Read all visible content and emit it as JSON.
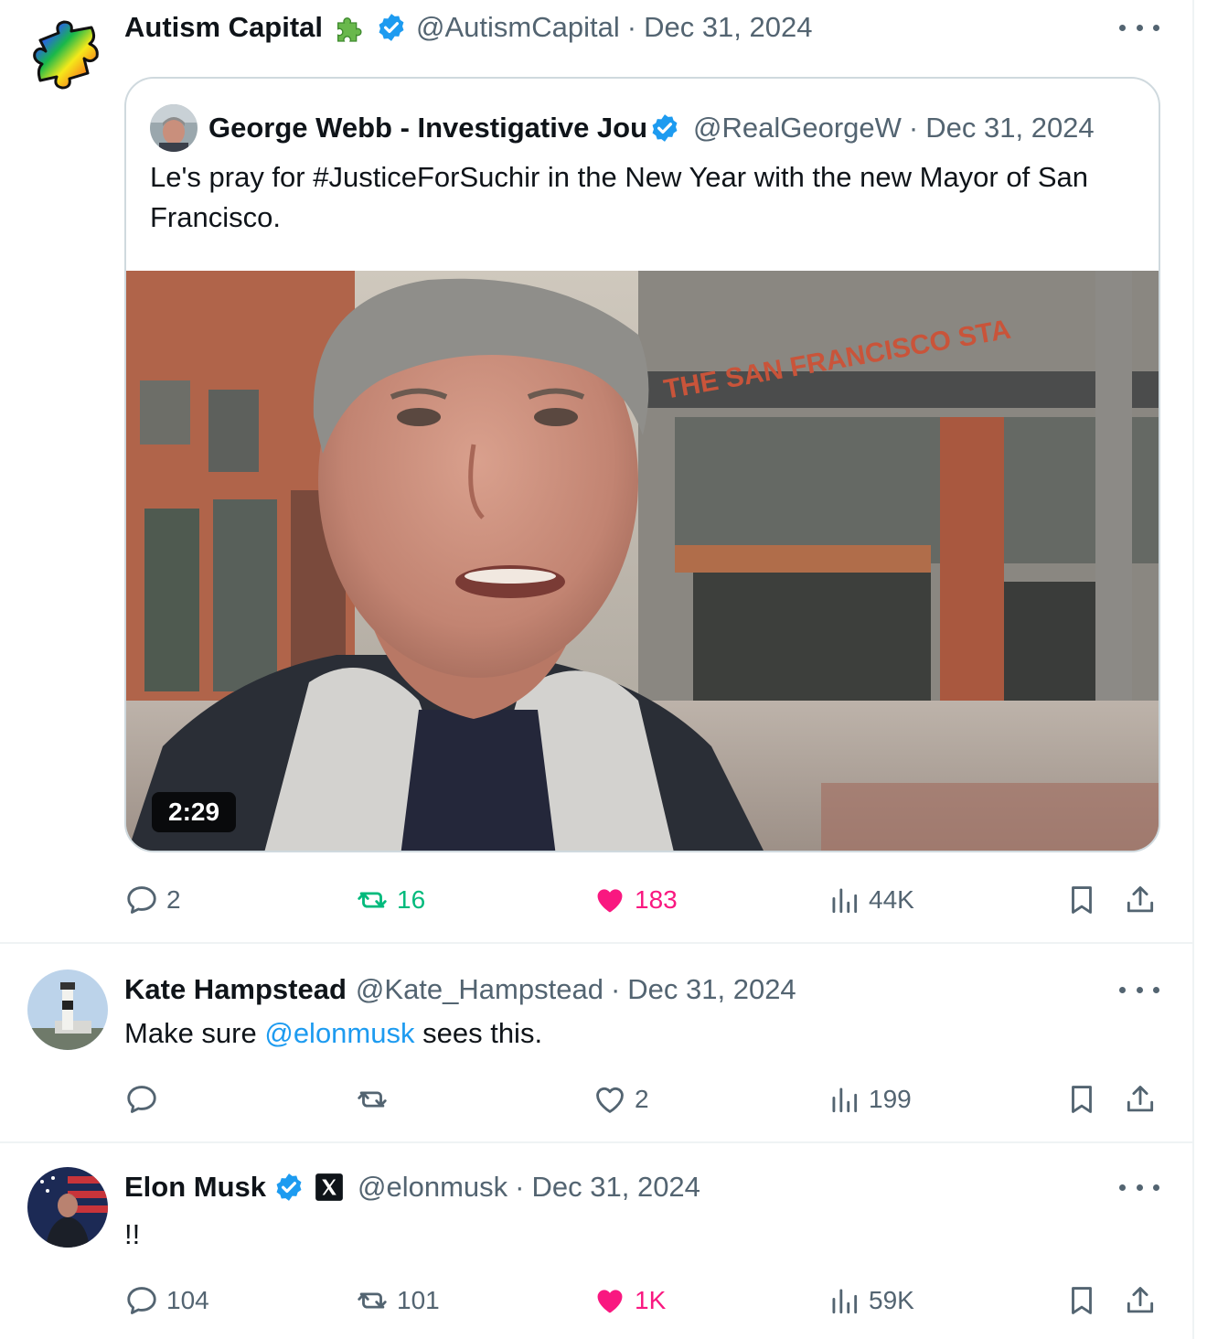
{
  "tweets": [
    {
      "author": "Autism Capital",
      "handle": "@AutismCapital",
      "date": "Dec 31, 2024",
      "quote": {
        "author": "George Webb - Investigative Jou",
        "handle": "@RealGeorgeW",
        "date": "Dec 31, 2024",
        "text": "Le's pray for #JusticeForSuchir in the New Year with the new Mayor of San Francisco.",
        "sign_text": "THE SAN FRANCISCO STA",
        "video_duration": "2:29"
      },
      "metrics": {
        "replies": "2",
        "reposts": "16",
        "likes": "183",
        "views": "44K"
      }
    },
    {
      "author": "Kate Hampstead",
      "handle": "@Kate_Hampstead",
      "date": "Dec 31, 2024",
      "text_before": "Make sure ",
      "mention": "@elonmusk",
      "text_after": " sees this.",
      "metrics": {
        "replies": "",
        "reposts": "",
        "likes": "2",
        "views": "199"
      }
    },
    {
      "author": "Elon Musk",
      "handle": "@elonmusk",
      "date": "Dec 31, 2024",
      "text": "!!",
      "metrics": {
        "replies": "104",
        "reposts": "101",
        "likes": "1K",
        "views": "59K"
      }
    }
  ],
  "separator": "·",
  "colors": {
    "accent": "#1d9bf0",
    "repost": "#00ba7c",
    "like": "#f91880",
    "muted": "#536471",
    "border": "#cfd9de"
  },
  "icons": [
    "puzzle-avatar-icon",
    "puzzle-icon",
    "verified-badge-icon",
    "x-logo-icon",
    "reply-icon",
    "repost-icon",
    "like-icon",
    "views-icon",
    "bookmark-icon",
    "share-icon",
    "more-icon"
  ]
}
